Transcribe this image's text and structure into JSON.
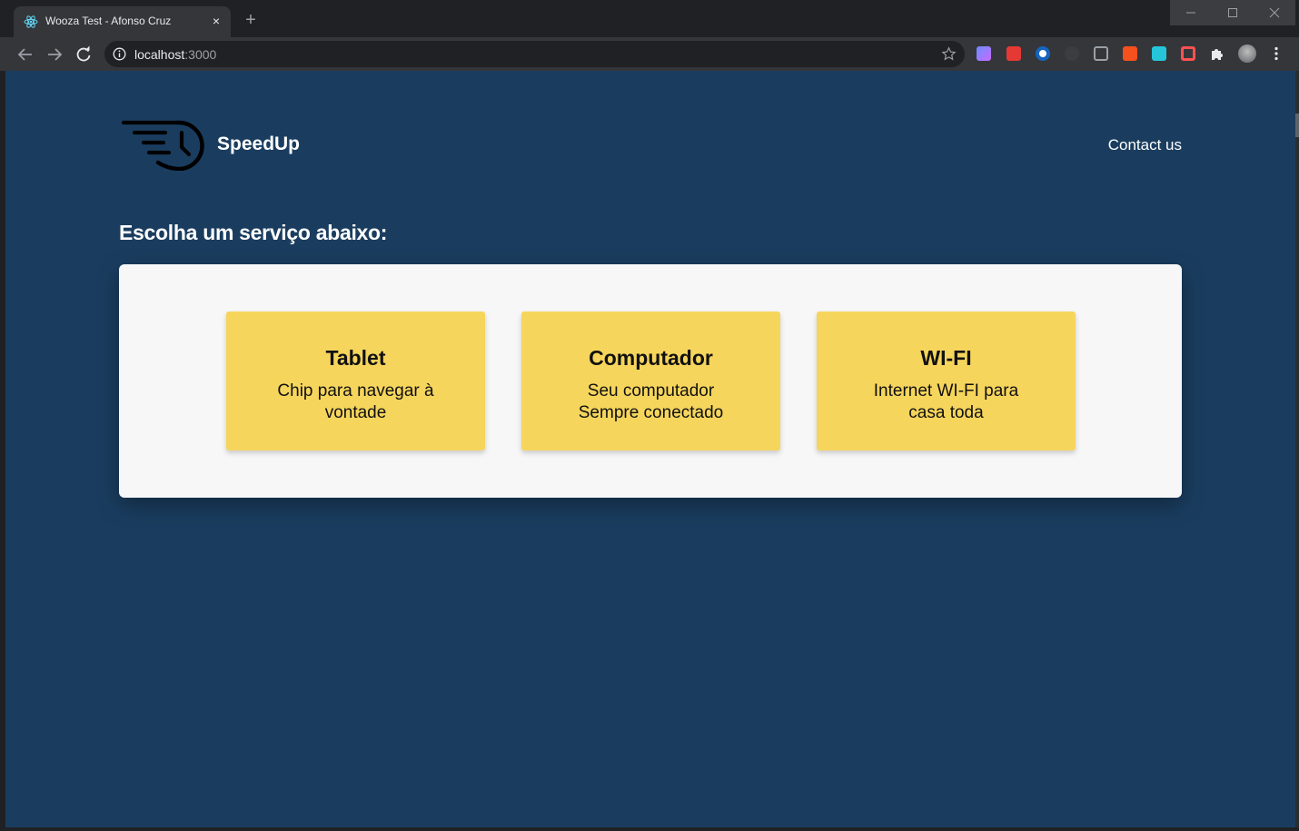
{
  "browser": {
    "tab_title": "Wooza Test - Afonso Cruz",
    "url_host": "localhost",
    "url_port": ":3000",
    "new_tab_glyph": "+",
    "close_glyph": "×",
    "extensions": [
      "purple-ext-icon",
      "red-ext-icon",
      "blue-circle-ext-icon",
      "gray-ext-icon",
      "code-ext-icon",
      "off-badge-ext-icon",
      "teal-ext-icon",
      "p-ext-icon",
      "puzzle-icon",
      "avatar"
    ]
  },
  "page": {
    "brand_name": "SpeedUp",
    "contact_label": "Contact us",
    "heading": "Escolha um serviço abaixo:",
    "services": [
      {
        "title": "Tablet",
        "description": "Chip para navegar à vontade"
      },
      {
        "title": "Computador",
        "description": "Seu computador Sempre conectado"
      },
      {
        "title": "WI-FI",
        "description": "Internet WI-FI para casa toda"
      }
    ]
  },
  "colors": {
    "page_background": "#1a3d5f",
    "card_background": "#f6d55c",
    "panel_background": "#f7f7f7"
  }
}
